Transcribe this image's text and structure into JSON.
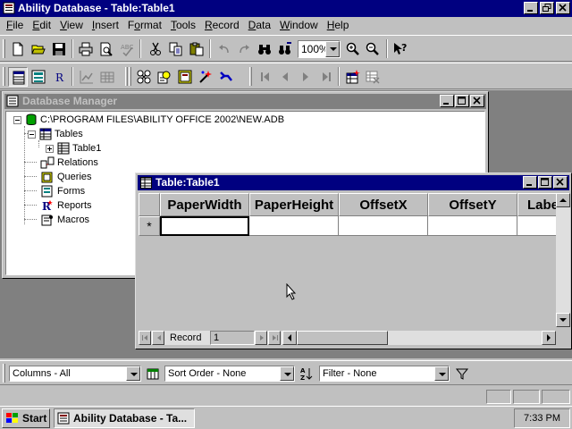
{
  "app": {
    "title": "Ability Database - Table:Table1"
  },
  "menu": [
    {
      "label": "File",
      "key": "F"
    },
    {
      "label": "Edit",
      "key": "E"
    },
    {
      "label": "View",
      "key": "V"
    },
    {
      "label": "Insert",
      "key": "I"
    },
    {
      "label": "Format",
      "key": "o"
    },
    {
      "label": "Tools",
      "key": "T"
    },
    {
      "label": "Record",
      "key": "R"
    },
    {
      "label": "Data",
      "key": "D"
    },
    {
      "label": "Window",
      "key": "W"
    },
    {
      "label": "Help",
      "key": "H"
    }
  ],
  "toolbar": {
    "zoom": "100%"
  },
  "database_manager": {
    "title": "Database Manager",
    "path": "C:\\PROGRAM FILES\\ABILITY OFFICE 2002\\NEW.ADB",
    "tables_label": "Tables",
    "table1_label": "Table1",
    "relations_label": "Relations",
    "queries_label": "Queries",
    "forms_label": "Forms",
    "reports_label": "Reports",
    "macros_label": "Macros"
  },
  "table_window": {
    "title": "Table:Table1",
    "columns": [
      "PaperWidth",
      "PaperHeight",
      "OffsetX",
      "OffsetY",
      "Labe"
    ],
    "new_row_marker": "*",
    "record_label": "Record",
    "record_number": "1"
  },
  "filter_bar": {
    "columns": "Columns - All",
    "sort_order": "Sort Order - None",
    "filter": "Filter - None"
  },
  "taskbar": {
    "start_label": "Start",
    "task_label": "Ability Database - Ta...",
    "clock": "7:33 PM"
  },
  "colors": {
    "active_caption": "#000080",
    "inactive_caption": "#808080",
    "face": "#c0c0c0"
  }
}
